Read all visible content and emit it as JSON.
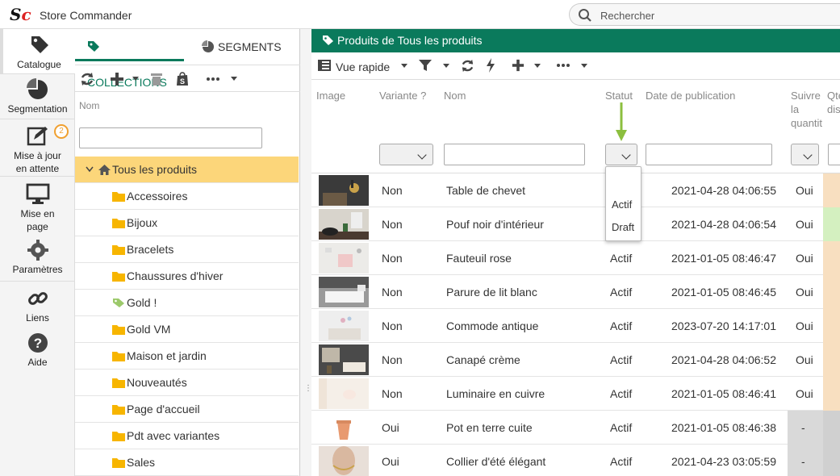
{
  "app": {
    "title": "Store Commander",
    "logo_s": "S",
    "logo_c": "c"
  },
  "search": {
    "placeholder": "Rechercher"
  },
  "nav": {
    "items": [
      {
        "label": "Catalogue",
        "icon": "tag-icon"
      },
      {
        "label": "Segmentation",
        "icon": "pie-chart-icon"
      },
      {
        "label_1": "Mise à jour",
        "label_2": "en attente",
        "icon": "edit-icon",
        "badge": "2"
      },
      {
        "label_1": "Mise en",
        "label_2": "page",
        "icon": "monitor-icon"
      },
      {
        "label": "Paramètres",
        "icon": "gear-icon"
      },
      {
        "label": "Liens",
        "icon": "link-icon"
      },
      {
        "label": "Aide",
        "icon": "help-icon"
      }
    ]
  },
  "collections": {
    "tabs": [
      {
        "label": "COLLECTIONS"
      },
      {
        "label": "SEGMENTS"
      }
    ],
    "header": "Nom",
    "root": "Tous les produits",
    "items": [
      "Accessoires",
      "Bijoux",
      "Bracelets",
      "Chaussures d'hiver",
      "Gold !",
      "Gold VM",
      "Maison et jardin",
      "Nouveautés",
      "Page d'accueil",
      "Pdt avec variantes",
      "Sales"
    ]
  },
  "products": {
    "title": "Produits de Tous les produits",
    "view": "Vue rapide",
    "columns": {
      "image": "Image",
      "variant": "Variante ?",
      "name": "Nom",
      "status": "Statut",
      "date": "Date de publication",
      "follow_1": "Suivre",
      "follow_2": "la",
      "follow_3": "quantit",
      "qty_1": "Qté",
      "qty_2": "dis"
    },
    "status_options": [
      "Actif",
      "Draft"
    ],
    "rows": [
      {
        "variant": "Non",
        "name": "Table de chevet",
        "status": "",
        "date": "2021-04-28 04:06:55",
        "follow": "Oui",
        "side": "#f8dfc0"
      },
      {
        "variant": "Non",
        "name": "Pouf noir d'intérieur",
        "status": "",
        "date": "2021-04-28 04:06:54",
        "follow": "Oui",
        "side": "#d4f0c0"
      },
      {
        "variant": "Non",
        "name": "Fauteuil rose",
        "status": "Actif",
        "date": "2021-01-05 08:46:47",
        "follow": "Oui",
        "side": "#f8dfc0"
      },
      {
        "variant": "Non",
        "name": "Parure de lit blanc",
        "status": "Actif",
        "date": "2021-01-05 08:46:45",
        "follow": "Oui",
        "side": "#f8dfc0"
      },
      {
        "variant": "Non",
        "name": "Commode antique",
        "status": "Actif",
        "date": "2023-07-20 14:17:01",
        "follow": "Oui",
        "side": "#f8dfc0"
      },
      {
        "variant": "Non",
        "name": "Canapé crème",
        "status": "Actif",
        "date": "2021-04-28 04:06:52",
        "follow": "Oui",
        "side": "#f8dfc0"
      },
      {
        "variant": "Non",
        "name": "Luminaire en cuivre",
        "status": "Actif",
        "date": "2021-01-05 08:46:41",
        "follow": "Oui",
        "side": "#f8dfc0"
      },
      {
        "variant": "Oui",
        "name": "Pot en terre cuite",
        "status": "Actif",
        "date": "2021-01-05 08:46:38",
        "follow": "-",
        "side": "#d0d0d0"
      },
      {
        "variant": "Oui",
        "name": "Collier d'été élégant",
        "status": "Actif",
        "date": "2021-04-23 03:05:59",
        "follow": "-",
        "side": "#d0d0d0"
      }
    ]
  },
  "colors": {
    "accent": "#0a7a5c",
    "selected_row": "#fcd67a",
    "folder": "#f7b500",
    "arrow": "#8cbf3f"
  }
}
